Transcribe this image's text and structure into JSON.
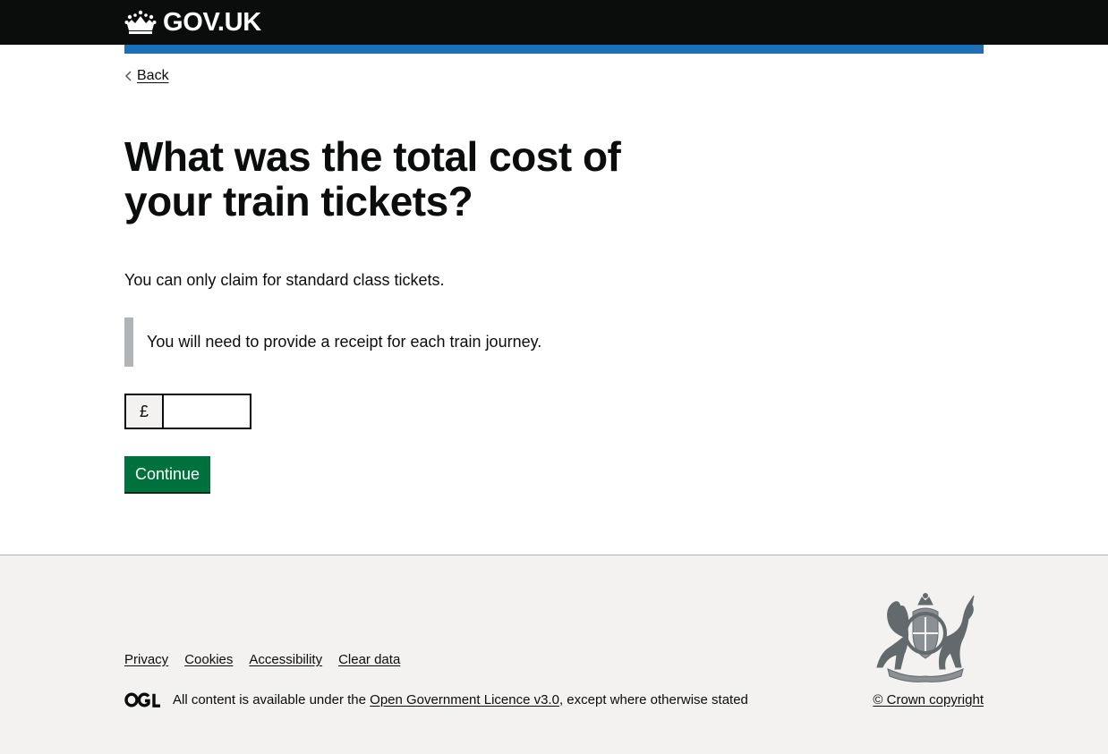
{
  "header": {
    "logo_text": "GOV.UK",
    "crown_icon": "crown-icon",
    "colors": {
      "background": "#0b0c0c",
      "accent_bar": "#1d70b8"
    }
  },
  "navigation": {
    "back_label": "Back",
    "back_icon": "chevron-left-icon"
  },
  "question": {
    "heading": "What was the total cost of your train tickets?",
    "hint": "You can only claim for standard class tickets.",
    "inset_text": "You will need to provide a receipt for each train journey."
  },
  "amount_field": {
    "prefix": "£",
    "value": "",
    "placeholder": ""
  },
  "continue_button": {
    "label": "Continue",
    "color": "#00703c"
  },
  "footer": {
    "links": [
      "Privacy",
      "Cookies",
      "Accessibility",
      "Clear data"
    ],
    "licence_prefix": "All content is available under the",
    "licence_link": "Open Government Licence v3.0",
    "licence_suffix": ", except where otherwise stated",
    "ogl_icon": "ogl-logo-icon",
    "crest_icon": "royal-coat-of-arms-icon",
    "copyright": "© Crown copyright"
  }
}
